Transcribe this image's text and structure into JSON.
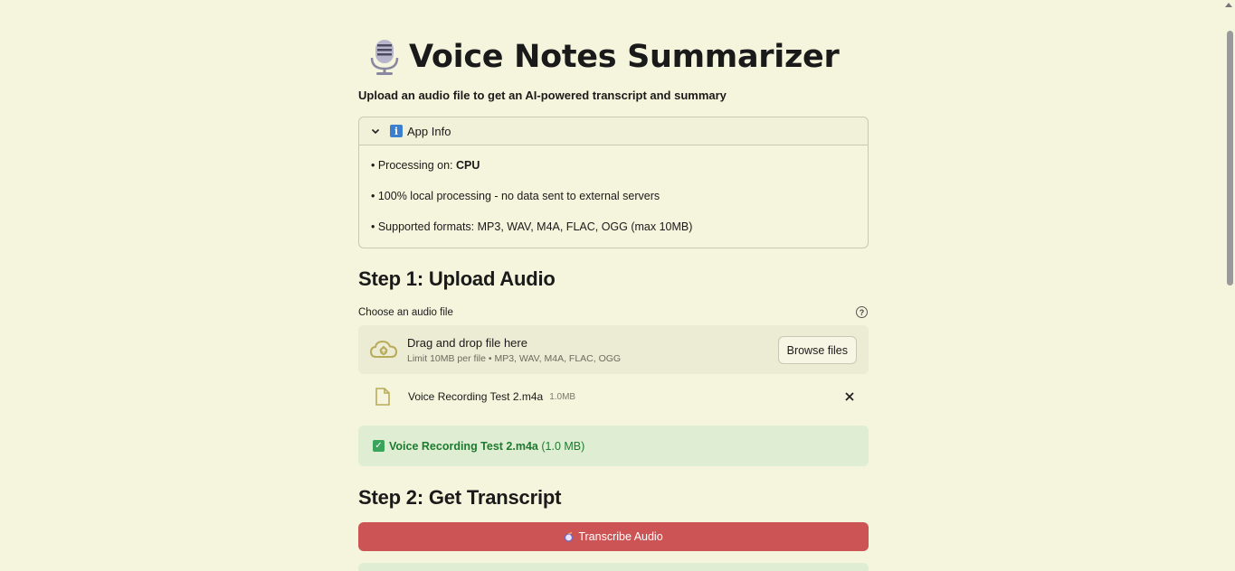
{
  "header": {
    "title_icon": "microphone-icon",
    "title": "Voice Notes Summarizer",
    "subtitle": "Upload an audio file to get an AI-powered transcript and summary"
  },
  "app_info": {
    "label": "App Info",
    "icon": "info-icon",
    "items": [
      {
        "prefix": "• Processing on: ",
        "bold": "CPU"
      },
      {
        "text": "• 100% local processing - no data sent to external servers"
      },
      {
        "text": "• Supported formats: MP3, WAV, M4A, FLAC, OGG (max 10MB)"
      }
    ]
  },
  "step1": {
    "heading": "Step 1: Upload Audio",
    "field_label": "Choose an audio file",
    "help_icon": "?",
    "dropzone_title": "Drag and drop file here",
    "dropzone_limit": "Limit 10MB per file • MP3, WAV, M4A, FLAC, OGG",
    "browse_label": "Browse files",
    "file": {
      "name": "Voice Recording Test 2.m4a",
      "size": "1.0MB"
    },
    "success": {
      "name": "Voice Recording Test 2.m4a",
      "size": "(1.0 MB)"
    }
  },
  "step2": {
    "heading": "Step 2: Get Transcript",
    "button_label": "Transcribe Audio"
  },
  "colors": {
    "background": "#f5f4dc",
    "primary_button": "#cc5454",
    "success_bg": "#dfeed3",
    "success_text": "#1d7a2f"
  }
}
